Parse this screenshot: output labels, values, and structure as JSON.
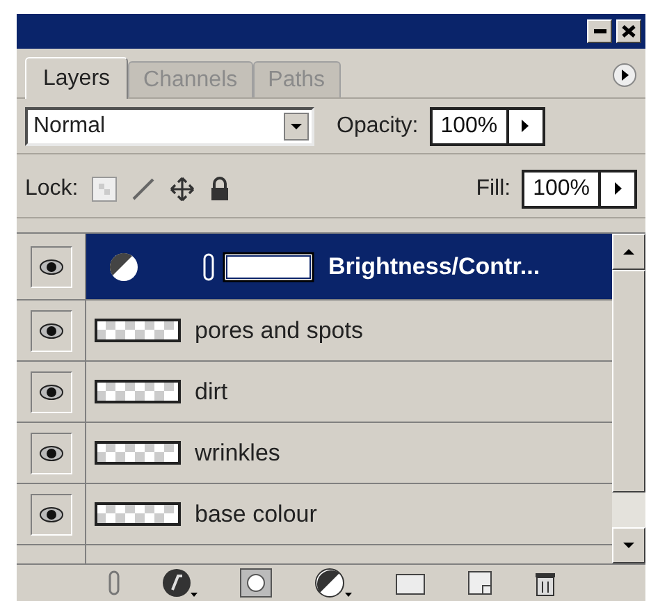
{
  "tabs": [
    {
      "label": "Layers",
      "selected": true
    },
    {
      "label": "Channels",
      "selected": false
    },
    {
      "label": "Paths",
      "selected": false
    }
  ],
  "blend_mode": {
    "value": "Normal"
  },
  "opacity": {
    "label": "Opacity:",
    "value": "100%"
  },
  "lock": {
    "label": "Lock:"
  },
  "fill": {
    "label": "Fill:",
    "value": "100%"
  },
  "layers": [
    {
      "kind": "adjustment",
      "name": "Brightness/Contr...",
      "visible": true,
      "selected": true
    },
    {
      "kind": "pixel",
      "name": "pores and spots",
      "visible": true,
      "selected": false
    },
    {
      "kind": "pixel",
      "name": "dirt",
      "visible": true,
      "selected": false
    },
    {
      "kind": "pixel",
      "name": "wrinkles",
      "visible": true,
      "selected": false
    },
    {
      "kind": "pixel",
      "name": "base colour",
      "visible": true,
      "selected": false
    }
  ]
}
